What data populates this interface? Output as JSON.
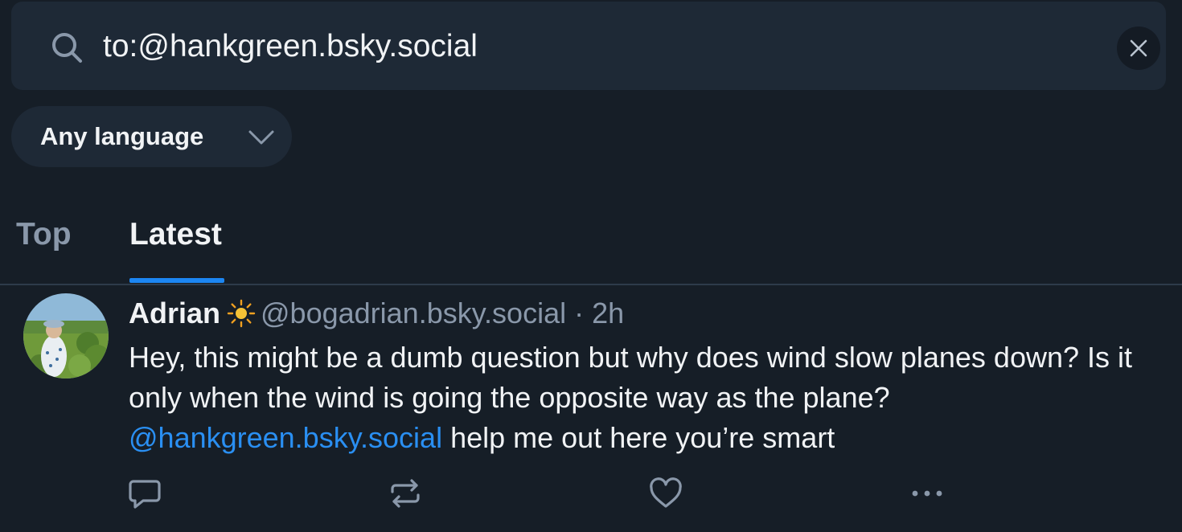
{
  "search": {
    "query": "to:@hankgreen.bsky.social"
  },
  "filter": {
    "language": "Any language"
  },
  "tabs": [
    {
      "label": "Top",
      "selected": false
    },
    {
      "label": "Latest",
      "selected": true
    }
  ],
  "post": {
    "author_name": "Adrian",
    "author_emoji": "sun",
    "author_handle": "@bogadrian.bsky.social",
    "separator": "·",
    "time": "2h",
    "text_part1": "Hey, this might be a dumb question but why does wind slow planes down? Is it only when the wind is going the opposite way as the plane? ",
    "mention": "@hankgreen.bsky.social",
    "text_part2": " help me out here you’re smart"
  },
  "actions": [
    "reply-icon",
    "repost-icon",
    "like-icon",
    "more-icon"
  ],
  "colors": {
    "background": "#161e27",
    "surface": "#1e2936",
    "accent": "#1c86f2",
    "link": "#2a8ff2",
    "muted": "#8a98aa"
  }
}
